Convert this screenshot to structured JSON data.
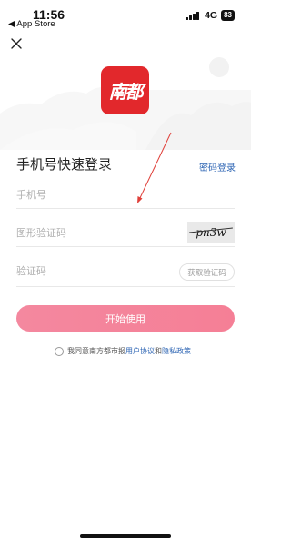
{
  "status_bar": {
    "time": "11:56",
    "back_app": "◀ App Store",
    "network": "4G",
    "battery": "83"
  },
  "logo": {
    "text": "南都",
    "color": "#e2282c"
  },
  "login": {
    "title": "手机号快速登录",
    "password_login": "密码登录",
    "phone_placeholder": "手机号",
    "captcha_placeholder": "图形验证码",
    "captcha_text": "pn3w",
    "code_placeholder": "验证码",
    "get_code": "获取验证码",
    "start": "开始使用"
  },
  "agreement": {
    "prefix": "我同意南方都市报",
    "user_agreement": "用户协议",
    "and": "和",
    "privacy": "隐私政策"
  },
  "colors": {
    "accent_link": "#2f66b4",
    "button": "#f4889f",
    "annotation_arrow": "#e0403a"
  }
}
